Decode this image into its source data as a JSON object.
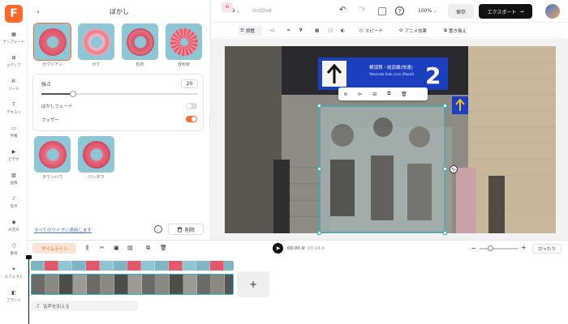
{
  "left_rail": {
    "logo_letter": "F",
    "items": [
      {
        "icon": "template-icon",
        "label": "テンプレート"
      },
      {
        "icon": "media-icon",
        "label": "メディア"
      },
      {
        "icon": "ai-tools-icon",
        "label": "ツール"
      },
      {
        "icon": "text-icon",
        "label": "テキスト"
      },
      {
        "icon": "subtitle-icon",
        "label": "字幕"
      },
      {
        "icon": "video-icon",
        "label": "ビデオ"
      },
      {
        "icon": "image-icon",
        "label": "画像"
      },
      {
        "icon": "audio-icon",
        "label": "音声"
      },
      {
        "icon": "ai-voice-icon",
        "label": "AI音声"
      },
      {
        "icon": "elements-icon",
        "label": "素材"
      },
      {
        "icon": "effects-icon",
        "label": "エフェクト"
      },
      {
        "icon": "brand-icon",
        "label": "ブランド"
      }
    ]
  },
  "panel": {
    "title": "ぼかし",
    "effects_row1": [
      {
        "label": "ガウシアン",
        "selected": true,
        "style": "gaussian"
      },
      {
        "label": "ボケ",
        "selected": false,
        "style": "bokeh"
      },
      {
        "label": "粒状",
        "selected": false,
        "style": "grain"
      },
      {
        "label": "放射状",
        "selected": false,
        "style": "radial"
      }
    ],
    "strength_label": "強さ",
    "strength_value": "20",
    "strength_fraction": 0.2,
    "blur_fade_label": "ぼかしフェード",
    "blur_fade_on": false,
    "feather_label": "フェザー",
    "feather_on": true,
    "effects_row2": [
      {
        "label": "タウンハウ",
        "style": "town"
      },
      {
        "label": "ジレダウ",
        "style": "jiredau"
      }
    ],
    "apply_all_link": "すべてのワイプに適用します",
    "delete_label": "削除"
  },
  "topbar": {
    "aspect": "16:9",
    "project_name": "Untitled",
    "zoom": "100%",
    "save_label": "保存",
    "export_label": "エクスポート"
  },
  "toolbar": {
    "ai_label": "AI",
    "adjust_label": "調整",
    "speed_label": "スピード",
    "anim_label": "アニメ効果",
    "replace_label": "置き換え"
  },
  "scene": {
    "sign_number": "2",
    "sign_text_line1": "横須賀・総武線(快速)",
    "sign_text_line2": "Yokosuka-Sobu Line (Rapid)"
  },
  "timeline": {
    "timeline_label": "タイムライン",
    "current_time": "00:00.0",
    "total_time": "00:14.4",
    "fit_label": "ぴったり",
    "add_audio_label": "音声を加える",
    "add_clip_symbol": "+"
  },
  "colors": {
    "accent": "#ff6a2c",
    "selection": "#2bb5c9",
    "donut_pink": "#e2596e",
    "thumb_bg": "#8fc6d6"
  }
}
